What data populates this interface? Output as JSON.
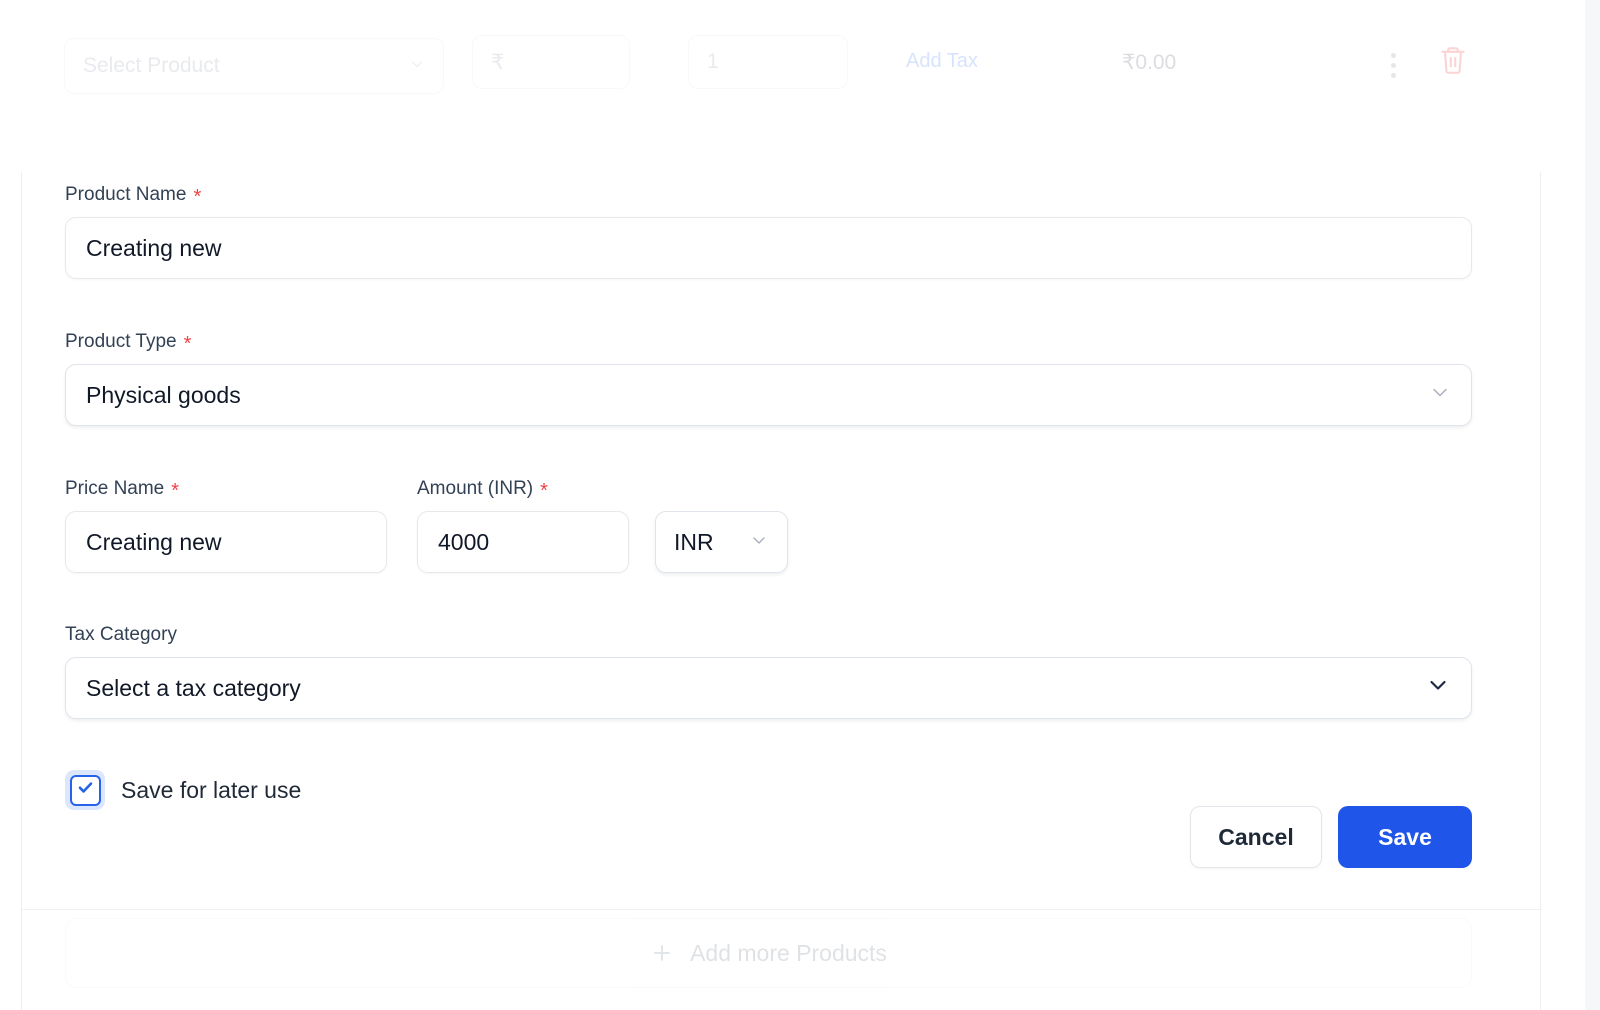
{
  "product_row": {
    "product_select": {
      "placeholder": "Select Product",
      "icon": "chevron-down-icon"
    },
    "price_field": {
      "value": "₹",
      "placeholder": "₹"
    },
    "quantity_field": {
      "value": "1",
      "placeholder": "1"
    },
    "add_tax_label": "Add Tax",
    "row_total": "₹0.00",
    "menu_icon": "kebab-menu-icon",
    "delete_icon": "trash-icon"
  },
  "form": {
    "product_name": {
      "label": "Product Name",
      "required_marker": "*",
      "value": "Creating new"
    },
    "product_type": {
      "label": "Product Type",
      "required_marker": "*",
      "value": "Physical goods",
      "icon": "chevron-down-icon"
    },
    "price_name": {
      "label": "Price Name",
      "required_marker": "*",
      "value": "Creating new"
    },
    "amount": {
      "label": "Amount (INR)",
      "required_marker": "*",
      "value": "4000"
    },
    "currency": {
      "value": "INR",
      "icon": "chevron-down-icon"
    },
    "tax_category": {
      "label": "Tax Category",
      "value": "Select a tax category",
      "icon": "chevron-down-icon"
    },
    "save_for_later": {
      "label": "Save for later use",
      "checked": true,
      "icon": "check-icon"
    },
    "actions": {
      "cancel_label": "Cancel",
      "save_label": "Save"
    }
  },
  "footer": {
    "add_more_label": "Add more Products",
    "plus_icon": "plus-icon"
  },
  "colors": {
    "accent": "#1f55e8",
    "link": "#4f82f3",
    "required": "#ef4444",
    "danger": "#ef4444",
    "label": "#334155",
    "text": "#111827",
    "muted": "#98a0ab",
    "page_bg": "#f6f7f9"
  }
}
